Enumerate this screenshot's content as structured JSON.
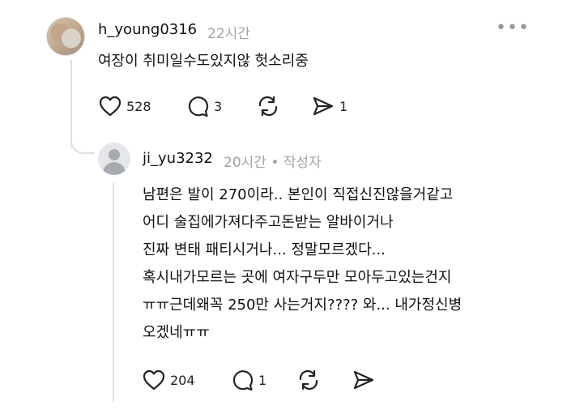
{
  "comment": {
    "username": "h_young0316",
    "time": "22시간",
    "text": "여장이 취미일수도있지않 헛소리중",
    "likes": "528",
    "replies": "3",
    "shares": "1"
  },
  "reply": {
    "username": "ji_yu3232",
    "time": "20시간 • 작성자",
    "lines": [
      "남편은 발이 270이라.. 본인이 직접신진않을거같고",
      "어디 술집에가져다주고돈받는 알바이거나",
      "진짜 변태 패티시거나... 정말모르겠다...",
      "혹시내가모르는 곳에 여자구두만 모아두고있는건지",
      "ㅠㅠ근데왜꼭 250만 사는거지???? 와... 내가정신병",
      "오겠네ㅠㅠ"
    ],
    "likes": "204",
    "replies": "1"
  },
  "more_glyph": "•••",
  "icons": [
    "heart-icon",
    "comment-icon",
    "repost-icon",
    "send-icon",
    "more-icon"
  ]
}
